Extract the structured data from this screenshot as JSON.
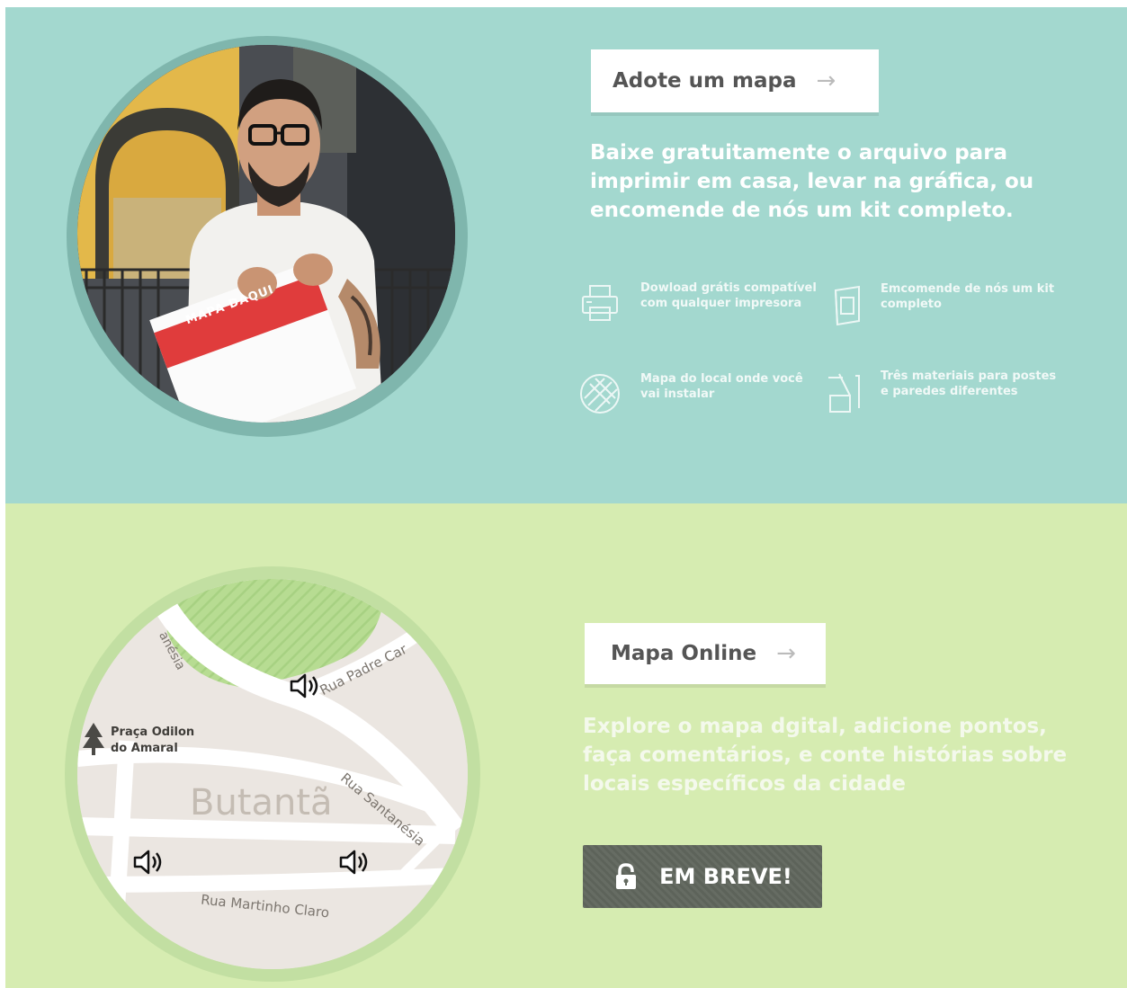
{
  "adopt_section": {
    "button_label": "Adote um mapa",
    "arrow_icon": "arrow-right-icon",
    "headline": "Baixe gratuitamente o arquivo para imprimir em casa, levar na gráfica, ou encomende de nós um kit completo.",
    "photo_sign_text": "MAPA DAQUI",
    "features": [
      {
        "icon": "printer-icon",
        "text": "Dowload grátis compatível com qualquer impresora"
      },
      {
        "icon": "kit-icon",
        "text": "Emcomende de nós um kit completo"
      },
      {
        "icon": "map-tile-icon",
        "text": "Mapa do local onde você vai instalar"
      },
      {
        "icon": "materials-icon",
        "text": "Três materiais para postes e paredes diferentes"
      }
    ],
    "colors": {
      "background": "#a3d8cf",
      "circle_ring": "#7fb6ad"
    }
  },
  "online_section": {
    "button_label": "Mapa Online",
    "arrow_icon": "arrow-right-icon",
    "headline": "Explore o mapa dgital, adicione pontos, faça comentários, e conte histórias sobre locais específicos da cidade",
    "soon_button_label": "EM BREVE!",
    "soon_button_icon": "lock-icon",
    "map": {
      "neighborhood": "Butantã",
      "park_label_line1": "Praça Odilon",
      "park_label_line2": "do Amaral",
      "streets": [
        "Rua Padre Car",
        "Rua Santanésia",
        "Rua Martinho Claro",
        "anésia"
      ],
      "markers": [
        "speaker-icon",
        "speaker-icon",
        "speaker-icon"
      ]
    },
    "colors": {
      "background": "#d6ecb1",
      "circle_ring": "#c2dfa2",
      "button": "#63695f"
    }
  }
}
